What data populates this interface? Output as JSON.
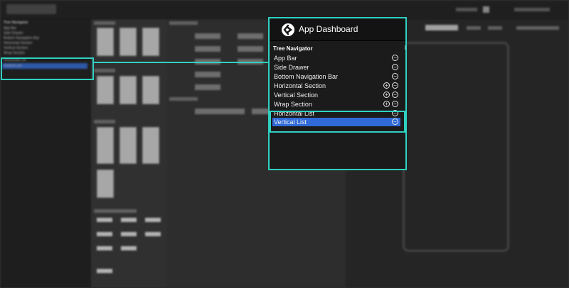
{
  "background_app": {
    "window_title": "App Dashboard",
    "tree_title": "Tree Navigator",
    "tree_items": [
      "App Bar",
      "Side Drawer",
      "Bottom Navigation Bar",
      "Horizontal Section",
      "Vertical Section",
      "Wrap Section",
      "Horizontal List",
      "Vertical List"
    ]
  },
  "zoom_panel": {
    "title": "App Dashboard",
    "section_title": "Tree Navigator",
    "items": [
      {
        "label": "App Bar",
        "add": false,
        "remove": true,
        "selected": false
      },
      {
        "label": "Side Drawer",
        "add": false,
        "remove": true,
        "selected": false
      },
      {
        "label": "Bottom Navigation Bar",
        "add": false,
        "remove": true,
        "selected": false
      },
      {
        "label": "Horizontal Section",
        "add": true,
        "remove": true,
        "selected": false
      },
      {
        "label": "Vertical Section",
        "add": true,
        "remove": true,
        "selected": false
      },
      {
        "label": "Wrap Section",
        "add": true,
        "remove": true,
        "selected": false
      },
      {
        "label": "Horizontal List",
        "add": false,
        "remove": true,
        "selected": false
      },
      {
        "label": "Vertical List",
        "add": false,
        "remove": true,
        "selected": true
      }
    ]
  },
  "icons": {
    "add": "plus-circle-icon",
    "remove": "minus-circle-icon",
    "logo": "app-dashboard-logo-icon"
  },
  "colors": {
    "accent": "#2fd1c0",
    "selection": "#2f6ad8",
    "panel_bg": "#1b1b1b"
  },
  "controls": {
    "plus_glyph": "+",
    "minus_glyph": "−"
  }
}
